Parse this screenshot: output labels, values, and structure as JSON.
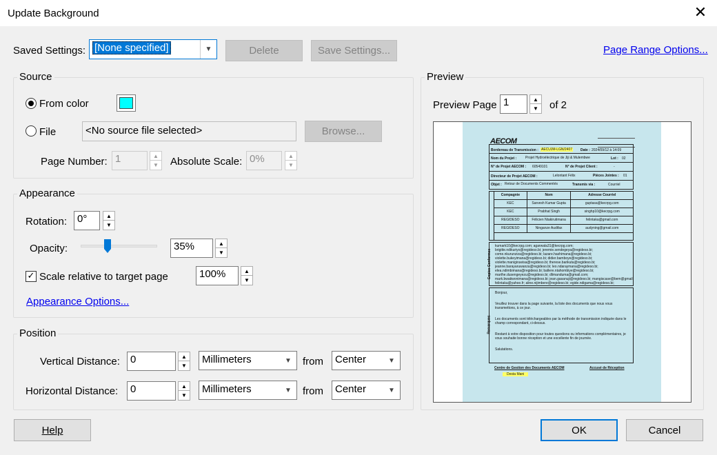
{
  "window": {
    "title": "Update Background"
  },
  "icons": {
    "close": "close-icon",
    "spin_up": "▲",
    "spin_down": "▼",
    "dropdown": "chevron-down-icon"
  },
  "colors": {
    "from_color_swatch": "#00ffff",
    "preview_bg": "#c7e6ed"
  },
  "saved_settings": {
    "label": "Saved Settings:",
    "value": "[None specified]",
    "delete_label": "Delete",
    "save_label": "Save Settings..."
  },
  "page_range_link": "Page Range Options...",
  "source": {
    "title": "Source",
    "from_color_label": "From color",
    "from_color_checked": true,
    "file_label": "File",
    "file_value": "<No source file selected>",
    "browse_label": "Browse...",
    "page_number_label": "Page Number:",
    "page_number_value": "1",
    "absolute_scale_label": "Absolute Scale:",
    "absolute_scale_value": "0%"
  },
  "appearance": {
    "title": "Appearance",
    "rotation_label": "Rotation:",
    "rotation_value": "0°",
    "opacity_label": "Opacity:",
    "opacity_value": "35%",
    "opacity_fraction": 0.35,
    "scale_relative_label": "Scale relative to target page",
    "scale_relative_checked": true,
    "scale_value": "100%",
    "options_link": "Appearance Options..."
  },
  "position": {
    "title": "Position",
    "vertical_label": "Vertical Distance:",
    "vertical_value": "0",
    "vertical_unit": "Millimeters",
    "vertical_from_label": "from",
    "vertical_from_value": "Center",
    "horizontal_label": "Horizontal Distance:",
    "horizontal_value": "0",
    "horizontal_unit": "Millimeters",
    "horizontal_from_label": "from",
    "horizontal_from_value": "Center"
  },
  "preview": {
    "title": "Preview",
    "page_label": "Preview Page",
    "page_value": "1",
    "page_total": "of 2",
    "doc": {
      "company": "AECOM",
      "transmission_label": "Bordereau de Transmission :",
      "transmission_value": "AECUJM-LGN/2407",
      "date_label": "Date :",
      "date_value": "2024/09/12 à 14:09",
      "project_label": "Nom du Projet :",
      "project_value": "Projet Hydroélectrique de Jiji & Mulembwe",
      "lot_label": "Lot :",
      "lot_value": "02",
      "aecom_no_label": "N° de Projet AECOM :",
      "aecom_no_value": "60549101",
      "client_no_label": "N° de Projet Client :",
      "client_no_value": "-",
      "director_label": "Directeur de Projet AECOM :",
      "director_value": "Lelontant Félix",
      "attached_label": "Pièces Jointes :",
      "attached_value": "01",
      "object_label": "Objet :",
      "object_value": "Retour de Documents Commentés",
      "sent_via_label": "Transmis via :",
      "sent_via_value": "Courriel",
      "table_headers": [
        "Compagnie",
        "Nom",
        "Adresse Courriel"
      ],
      "table_rows": [
        [
          "KEC",
          "Sarvesh Kumar Gupta",
          "guptasa@kecrpg.com"
        ],
        [
          "KEC",
          "Prabhat Singh",
          "singhp10@kecrpg.com"
        ],
        [
          "REGIDESO",
          "Félicien Ntakirutimana",
          "felintaka@gmail.com"
        ],
        [
          "REGIDESO",
          "Ninganze Audifax",
          "audyning@gmail.com"
        ]
      ],
      "cc_label": "Copies Conformes",
      "cc_lines": [
        "kumark10@kecrpg.com; agarwala31@kecrpg.com;",
        "brigitte.ndikuriyo@regideso.bi; jeremie.sendegeya@regideso.bi;",
        "come.nkurunziza@regideso.bi; lazare.hashimana@regideso.bi;",
        "violette.bukeyimana@regideso.bi; didier.bamboye@regideso.bi;",
        "violette.manigiruwisa@regideso.bi; therese.barikuta@regideso.bi;",
        "jeanne.barayaruwanza@regideso.bi; leo.ndaraymana@regideso.bi;",
        "elea.ndimbimana@regideso.bi; ballere.ntahombiye@regideso.bi;",
        "marthe.dusengeyezu@regideso.bi; dlimanduma@gmail.com;",
        "mark.bwatiwonimana@regideso.bi; jean.gasanuji@regideso.bi; mangiscase@bem@gmail.com;",
        "felintaka@yahoo.fr; aline.nijimbere@regideso.bi; egide.ndigama@regideso.bi;"
      ],
      "remarks_label": "Remarques",
      "remarks": [
        "Bonjour,",
        "Veuillez trouver dans la page suivante, la liste des documents que nous vous transmettons, à ce jour.",
        "Les documents sont téléchargeables par la méthode de transmission indiquée dans le champ correspondant, ci-dessus.",
        "Restant à votre disposition pour toutes questions ou informations complémentaires, je vous souhaite bonne réception et une excellente fin de journée.",
        "Salutations."
      ],
      "footer_left": "Centre de Gestion des Documents AECOM",
      "footer_right": "Accusé de Réception",
      "footer_name": "Desta Mani"
    }
  },
  "buttons": {
    "help": "Help",
    "ok": "OK",
    "cancel": "Cancel"
  }
}
